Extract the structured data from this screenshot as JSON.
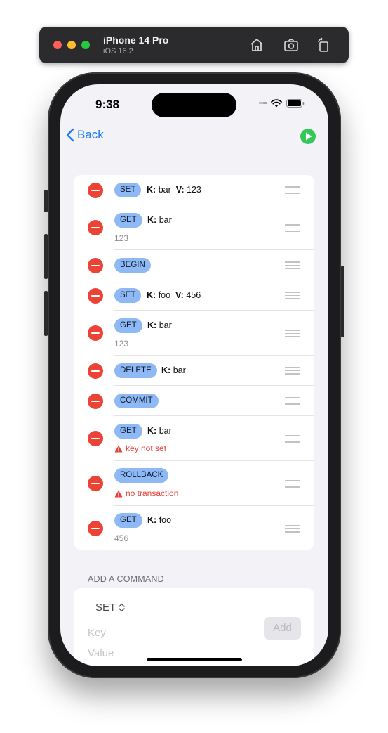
{
  "simulator": {
    "device_name": "iPhone 14 Pro",
    "os_version": "iOS 16.2"
  },
  "status_bar": {
    "time": "9:38"
  },
  "nav": {
    "back_label": "Back"
  },
  "colors": {
    "accent": "#1a7cf5",
    "delete_red": "#eb4436",
    "play_green": "#34c759",
    "pill_blue": "#8fb9f4",
    "error_red": "#e5413a"
  },
  "commands": [
    {
      "op": "SET",
      "k_label": "K:",
      "key": "bar",
      "v_label": "V:",
      "value": "123"
    },
    {
      "op": "GET",
      "k_label": "K:",
      "key": "bar",
      "result": "123"
    },
    {
      "op": "BEGIN"
    },
    {
      "op": "SET",
      "k_label": "K:",
      "key": "foo",
      "v_label": "V:",
      "value": "456"
    },
    {
      "op": "GET",
      "k_label": "K:",
      "key": "bar",
      "result": "123"
    },
    {
      "op": "DELETE",
      "k_label": "K:",
      "key": "bar"
    },
    {
      "op": "COMMIT"
    },
    {
      "op": "GET",
      "k_label": "K:",
      "key": "bar",
      "error": "key not set"
    },
    {
      "op": "ROLLBACK",
      "error": "no transaction"
    },
    {
      "op": "GET",
      "k_label": "K:",
      "key": "foo",
      "result": "456"
    }
  ],
  "add_section": {
    "header": "ADD A COMMAND",
    "selected_command": "SET",
    "key_placeholder": "Key",
    "value_placeholder": "Value",
    "add_label": "Add"
  }
}
